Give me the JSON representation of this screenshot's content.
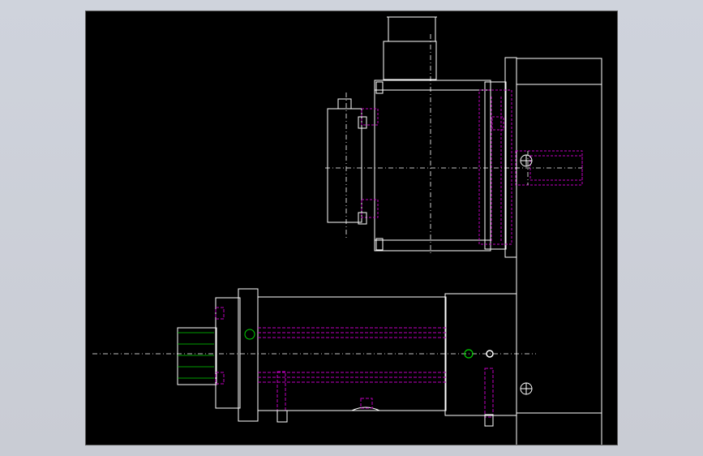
{
  "colors": {
    "background": "#000000",
    "outline": "#ffffff",
    "hidden_lines": "#c000c0",
    "highlight_circle": "#00d000",
    "frame": "#cfd3dc"
  },
  "canvas": {
    "grid": false
  }
}
